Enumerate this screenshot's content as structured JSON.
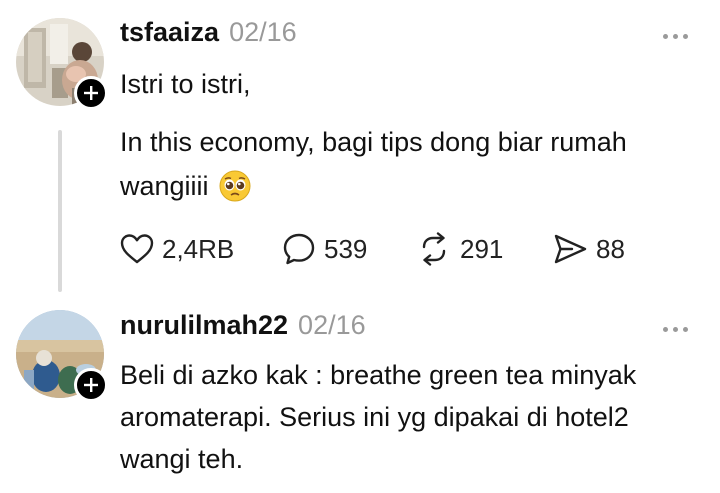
{
  "posts": [
    {
      "username": "tsfaaiza",
      "date": "02/16",
      "lines": [
        "Istri to istri,",
        "In this economy, bagi tips dong biar rumah",
        "wangiiii"
      ],
      "emoji": "pleading-face-emoji",
      "actions": {
        "likes": "2,4RB",
        "replies": "539",
        "reposts": "291",
        "shares": "88"
      }
    },
    {
      "username": "nurulilmah22",
      "date": "02/16",
      "lines": [
        "Beli di azko kak : breathe green tea minyak",
        "aromaterapi. Serius ini yg dipakai di hotel2",
        "wangi teh."
      ]
    }
  ],
  "icons": {
    "like": "heart-icon",
    "reply": "comment-bubble-icon",
    "repost": "repost-icon",
    "share": "send-icon",
    "more": "more-dots-icon",
    "follow": "plus-icon"
  },
  "colors": {
    "text": "#111111",
    "muted": "#999999",
    "thread_line": "#d9d9d9",
    "badge": "#000000"
  }
}
